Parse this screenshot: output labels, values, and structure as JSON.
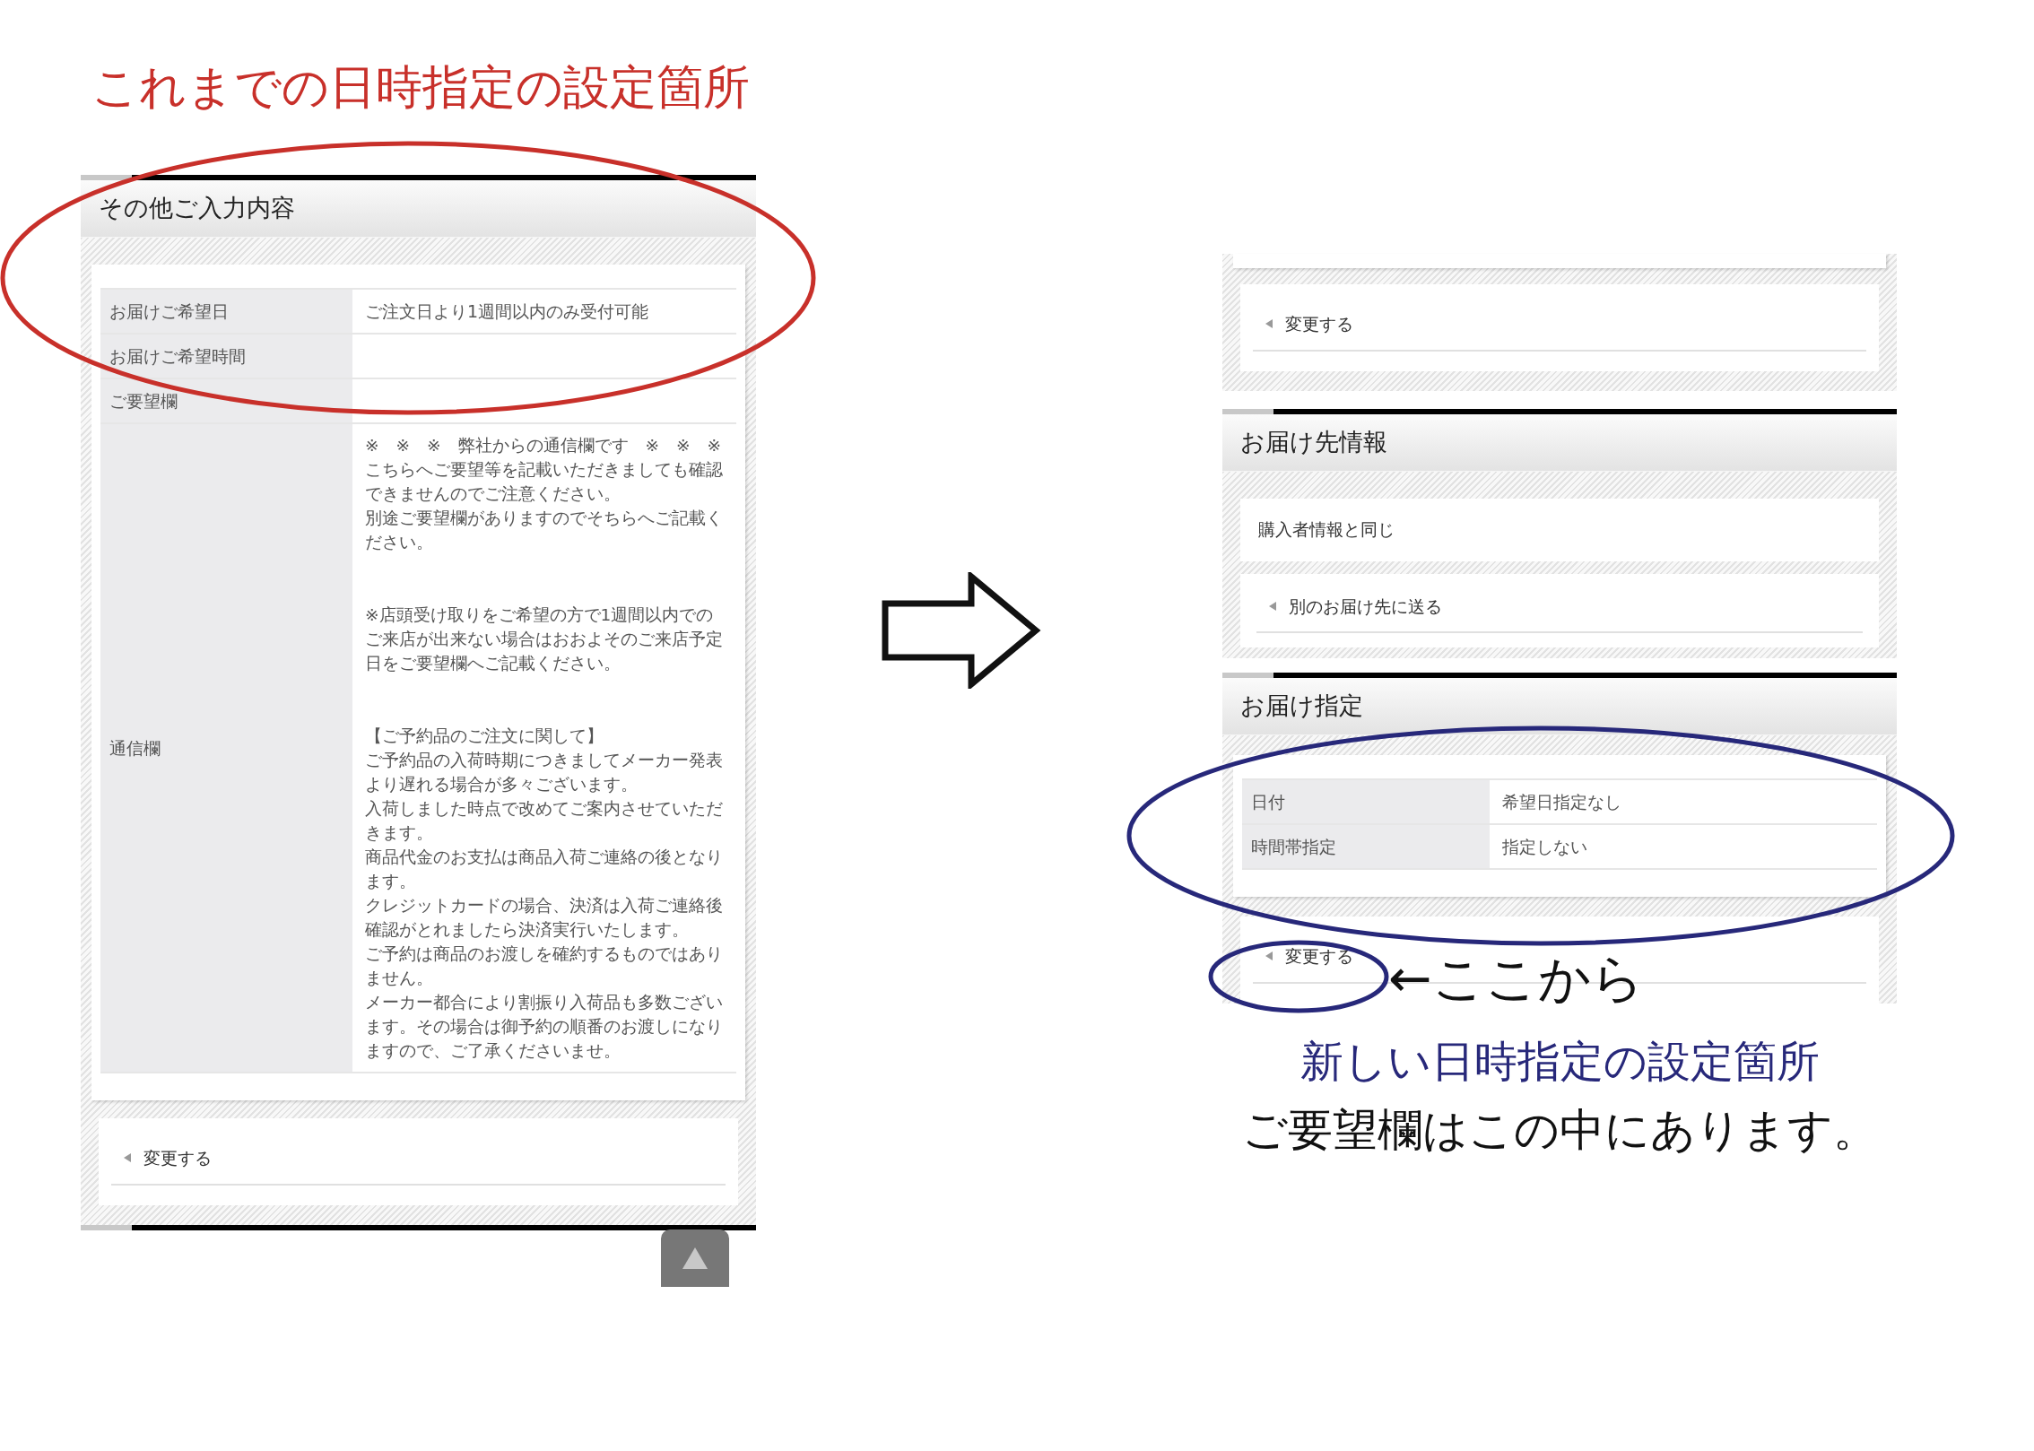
{
  "old_section": {
    "caption": "これまでの日時指定の設定箇所",
    "heading": "その他ご入力内容",
    "rows": [
      {
        "label": "お届けご希望日",
        "value": "ご注文日より1週間以内のみ受付可能"
      },
      {
        "label": "お届けご希望時間"
      },
      {
        "label": "ご要望欄"
      },
      {
        "label": "通信欄",
        "blocks": [
          [
            "※　※　※　弊社からの通信欄です　※　※　※",
            "こちらへご要望等を記載いただきましても確認できませんのでご注意ください。",
            "別途ご要望欄がありますのでそちらへご記載ください。"
          ],
          [
            "※店頭受け取りをご希望の方で1週間以内でのご来店が出来ない場合はおおよそのご来店予定日をご要望欄へご記載ください。"
          ],
          [
            "【ご予約品のご注文に関して】",
            "ご予約品の入荷時期につきましてメーカー発表より遅れる場合が多々ございます。",
            "入荷しました時点で改めてご案内させていただきます。",
            "商品代金のお支払は商品入荷ご連絡の後となります。",
            "クレジットカードの場合、決済は入荷ご連絡後確認がとれましたら決済実行いたします。",
            "ご予約は商品のお渡しを確約するものではありません。",
            "メーカー都合により割振り入荷品も多数ございます。その場合は御予約の順番のお渡しになりますので、ご了承くださいませ。"
          ]
        ]
      }
    ],
    "change_link": "変更する"
  },
  "new_section": {
    "top_link": "変更する",
    "shipping": {
      "heading": "お届け先情報",
      "options": [
        {
          "label": "購入者情報と同じ",
          "kind": "plain"
        },
        {
          "label": "別のお届け先に送る",
          "kind": "link"
        }
      ]
    },
    "delivery": {
      "heading": "お届け指定",
      "rows": [
        {
          "label": "日付",
          "value": "希望日指定なし"
        },
        {
          "label": "時間帯指定",
          "value": "指定しない"
        }
      ],
      "change_link": "変更する"
    },
    "pointer_note": "←ここから",
    "caption": "新しい日時指定の設定箇所",
    "note": "ご要望欄はこの中にあります。"
  }
}
